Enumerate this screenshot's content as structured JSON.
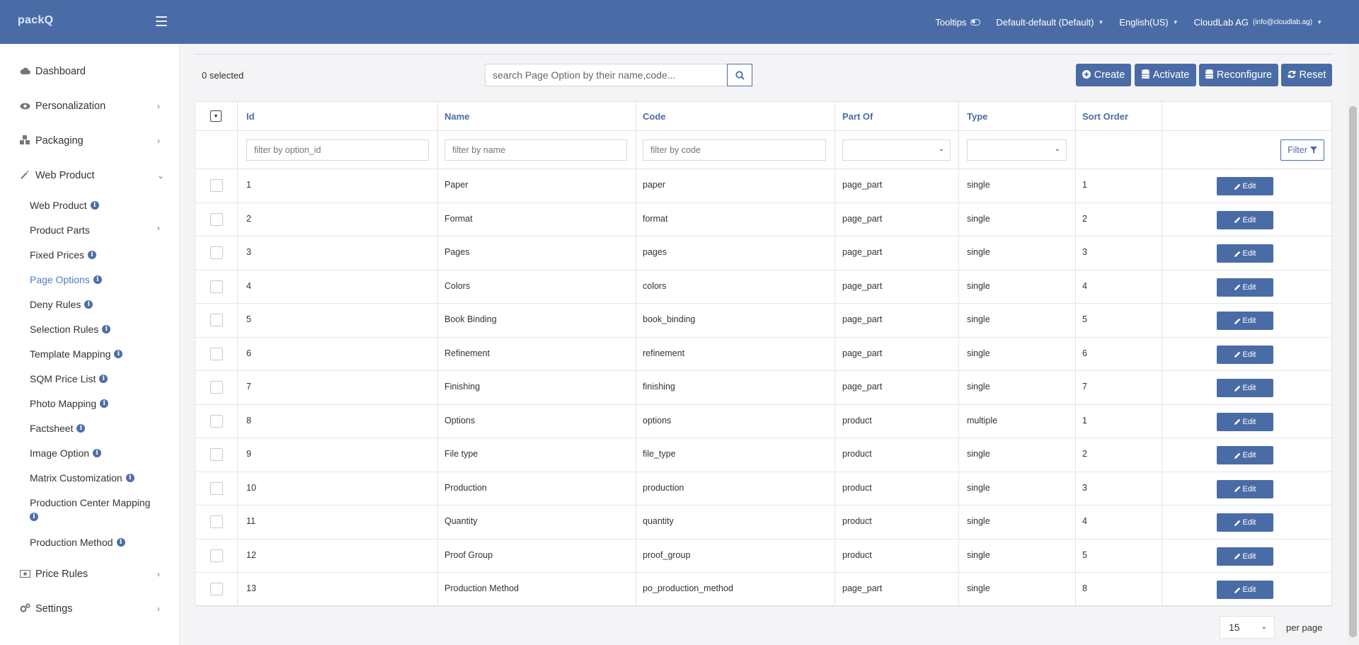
{
  "header": {
    "brand": "packQ",
    "tooltips_label": "Tooltips",
    "profile_select": "Default-default (Default)",
    "language": "English(US)",
    "account_name": "CloudLab AG",
    "account_email": "(info@cloudlab.ag)"
  },
  "sidebar": {
    "dashboard": "Dashboard",
    "personalization": "Personalization",
    "packaging": "Packaging",
    "web_product": "Web Product",
    "sub": {
      "web_product": "Web Product",
      "product_parts": "Product Parts",
      "fixed_prices": "Fixed Prices",
      "page_options": "Page Options",
      "deny_rules": "Deny Rules",
      "selection_rules": "Selection Rules",
      "template_mapping": "Template Mapping",
      "sqm_price_list": "SQM Price List",
      "photo_mapping": "Photo Mapping",
      "factsheet": "Factsheet",
      "image_option": "Image Option",
      "matrix_customization": "Matrix Customization",
      "production_center_mapping": "Production Center Mapping",
      "production_method": "Production Method"
    },
    "price_rules": "Price Rules",
    "settings": "Settings"
  },
  "toolbar": {
    "selected_text": "0 selected",
    "search_placeholder": "search Page Option by their name,code...",
    "create_label": "Create",
    "activate_label": "Activate",
    "reconfigure_label": "Reconfigure",
    "reset_label": "Reset"
  },
  "table": {
    "headers": {
      "id": "Id",
      "name": "Name",
      "code": "Code",
      "part_of": "Part Of",
      "type": "Type",
      "sort_order": "Sort Order"
    },
    "filters": {
      "id_placeholder": "filter by option_id",
      "name_placeholder": "filter by name",
      "code_placeholder": "filter by code",
      "filter_button": "Filter"
    },
    "edit_label": "Edit",
    "rows": [
      {
        "id": "1",
        "name": "Paper",
        "code": "paper",
        "part_of": "page_part",
        "type": "single",
        "sort": "1"
      },
      {
        "id": "2",
        "name": "Format",
        "code": "format",
        "part_of": "page_part",
        "type": "single",
        "sort": "2"
      },
      {
        "id": "3",
        "name": "Pages",
        "code": "pages",
        "part_of": "page_part",
        "type": "single",
        "sort": "3"
      },
      {
        "id": "4",
        "name": "Colors",
        "code": "colors",
        "part_of": "page_part",
        "type": "single",
        "sort": "4"
      },
      {
        "id": "5",
        "name": "Book Binding",
        "code": "book_binding",
        "part_of": "page_part",
        "type": "single",
        "sort": "5"
      },
      {
        "id": "6",
        "name": "Refinement",
        "code": "refinement",
        "part_of": "page_part",
        "type": "single",
        "sort": "6"
      },
      {
        "id": "7",
        "name": "Finishing",
        "code": "finishing",
        "part_of": "page_part",
        "type": "single",
        "sort": "7"
      },
      {
        "id": "8",
        "name": "Options",
        "code": "options",
        "part_of": "product",
        "type": "multiple",
        "sort": "1"
      },
      {
        "id": "9",
        "name": "File type",
        "code": "file_type",
        "part_of": "product",
        "type": "single",
        "sort": "2"
      },
      {
        "id": "10",
        "name": "Production",
        "code": "production",
        "part_of": "product",
        "type": "single",
        "sort": "3"
      },
      {
        "id": "11",
        "name": "Quantity",
        "code": "quantity",
        "part_of": "product",
        "type": "single",
        "sort": "4"
      },
      {
        "id": "12",
        "name": "Proof Group",
        "code": "proof_group",
        "part_of": "product",
        "type": "single",
        "sort": "5"
      },
      {
        "id": "13",
        "name": "Production Method",
        "code": "po_production_method",
        "part_of": "page_part",
        "type": "single",
        "sort": "8"
      }
    ]
  },
  "pagination": {
    "page_size": "15",
    "per_page_label": "per page"
  },
  "colors": {
    "primary": "#4a6ca6",
    "active_link": "#4a7fc1"
  }
}
